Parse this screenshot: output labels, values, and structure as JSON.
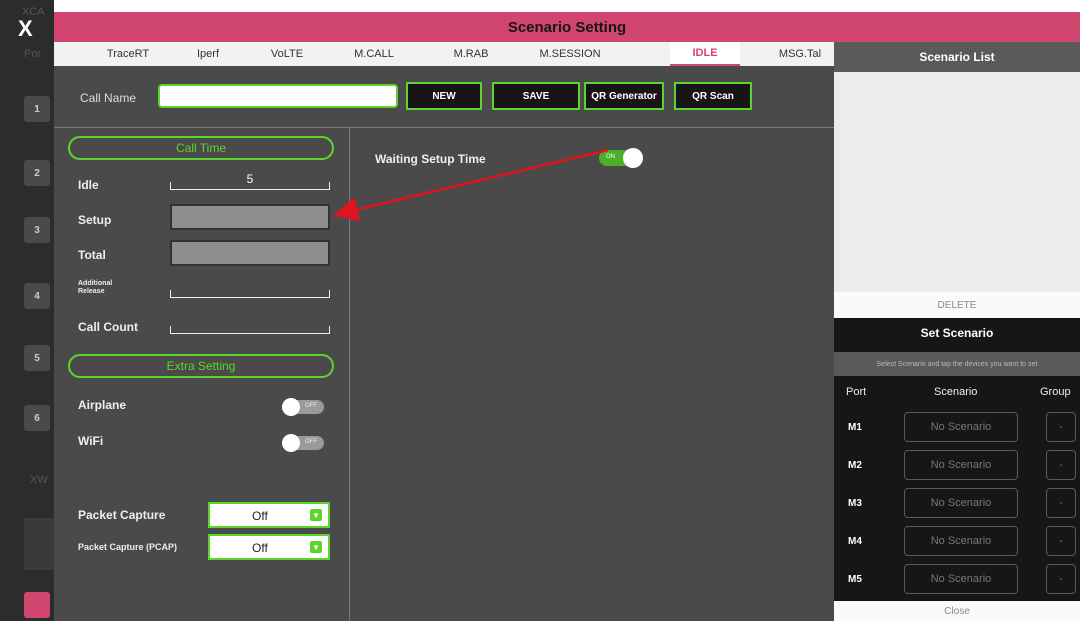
{
  "title": "Scenario Setting",
  "close_label": "X",
  "background": {
    "labels": [
      "XCA",
      "Por",
      "XW"
    ],
    "port_numbers": [
      "1",
      "2",
      "3",
      "4",
      "5",
      "6"
    ]
  },
  "tabs": [
    {
      "label": "TraceRT",
      "active": false
    },
    {
      "label": "Iperf",
      "active": false
    },
    {
      "label": "VoLTE",
      "active": false
    },
    {
      "label": "M.CALL",
      "active": false
    },
    {
      "label": "M.RAB",
      "active": false
    },
    {
      "label": "M.SESSION",
      "active": false
    },
    {
      "label": "IDLE",
      "active": true
    },
    {
      "label": "MSG.Tal",
      "active": false
    }
  ],
  "toolbar": {
    "call_name_label": "Call Name",
    "call_name_value": "",
    "new_label": "NEW",
    "save_label": "SAVE",
    "qr_generator_label": "QR Generator",
    "qr_scan_label": "QR Scan"
  },
  "call_time": {
    "section_label": "Call Time",
    "idle_label": "Idle",
    "idle_value": "5",
    "setup_label": "Setup",
    "total_label": "Total",
    "additional_release_label": "Additional Release",
    "call_count_label": "Call Count"
  },
  "extra_setting": {
    "section_label": "Extra Setting",
    "airplane_label": "Airplane",
    "airplane_state": "OFF",
    "wifi_label": "WiFi",
    "wifi_state": "OFF"
  },
  "packet_capture": {
    "label": "Packet Capture",
    "value": "Off",
    "pcap_label": "Packet Capture (PCAP)",
    "pcap_value": "Off"
  },
  "waiting_setup_time": {
    "label": "Waiting Setup Time",
    "state": "ON"
  },
  "scenario_list": {
    "header": "Scenario List",
    "delete_label": "DELETE"
  },
  "set_scenario": {
    "title": "Set Scenario",
    "hint": "Select Scenario and tap the devices you want to set",
    "col_port": "Port",
    "col_scenario": "Scenario",
    "col_group": "Group",
    "rows": [
      {
        "port": "M1",
        "scenario": "No Scenario",
        "group": "-"
      },
      {
        "port": "M2",
        "scenario": "No Scenario",
        "group": "-"
      },
      {
        "port": "M3",
        "scenario": "No Scenario",
        "group": "-"
      },
      {
        "port": "M4",
        "scenario": "No Scenario",
        "group": "-"
      },
      {
        "port": "M5",
        "scenario": "No Scenario",
        "group": "-"
      }
    ],
    "close_label": "Close"
  },
  "colors": {
    "accent_pink": "#d1466f",
    "accent_green": "#5cd62c",
    "annotation_red": "#e0141e"
  }
}
